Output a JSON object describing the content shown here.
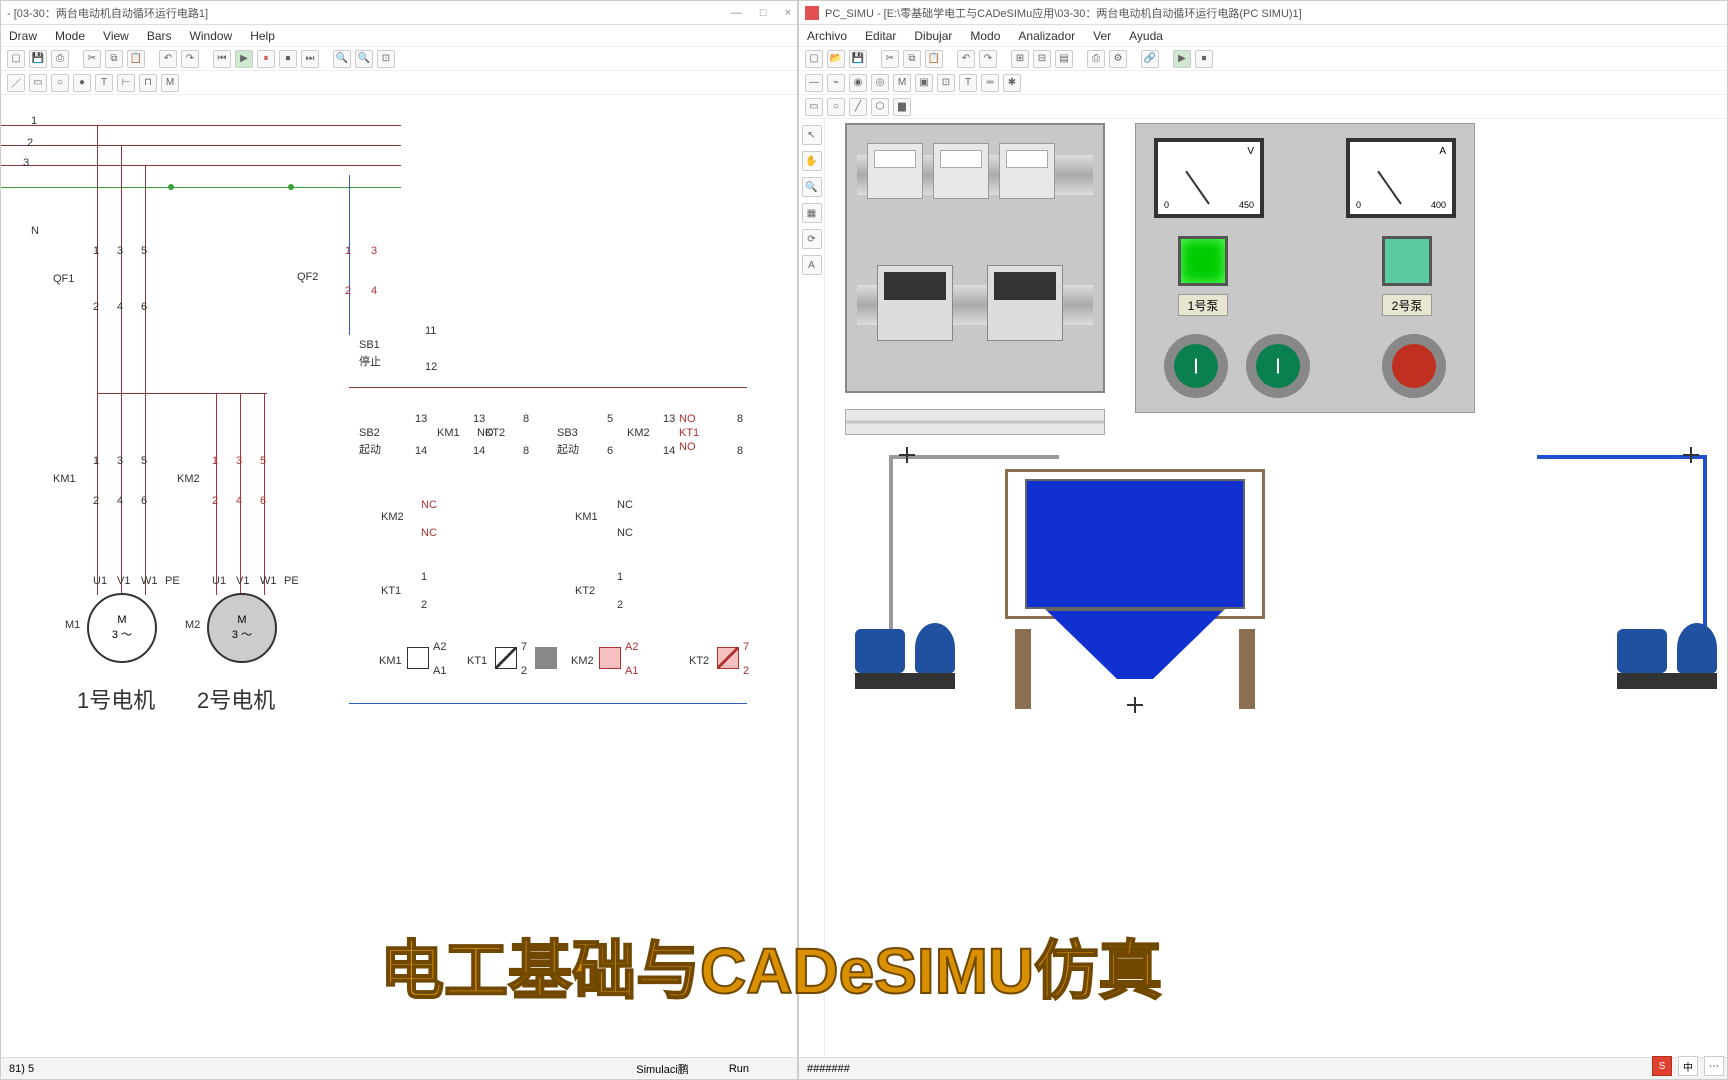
{
  "left_app": {
    "title": "- [03-30：两台电动机自动循环运行电路1]",
    "menus": [
      "Draw",
      "Mode",
      "View",
      "Bars",
      "Window",
      "Help"
    ],
    "status": {
      "left": "81) 5",
      "center": "Simulaci鹏",
      "right": "Run"
    }
  },
  "right_app": {
    "title": "PC_SIMU - [E:\\零基础学电工与CADeSIMu应用\\03-30：两台电动机自动循环运行电路(PC SIMU)1]",
    "menus": [
      "Archivo",
      "Editar",
      "Dibujar",
      "Modo",
      "Analizador",
      "Ver",
      "Ayuda"
    ],
    "status": "#######"
  },
  "schematic": {
    "phases": [
      "1",
      "2",
      "3",
      "N"
    ],
    "qf1": "QF1",
    "qf2": "QF2",
    "km1": "KM1",
    "km2": "KM2",
    "motor1": {
      "id": "M1",
      "label": "1号电机",
      "inside_top": "M",
      "inside_bot": "3 ～",
      "terms": [
        "U1",
        "V1",
        "W1",
        "PE"
      ]
    },
    "motor2": {
      "id": "M2",
      "label": "2号电机",
      "inside_top": "M",
      "inside_bot": "3 ～",
      "terms": [
        "U1",
        "V1",
        "W1",
        "PE"
      ]
    },
    "control": {
      "sb1": {
        "id": "SB1",
        "sub": "停止",
        "t": [
          "11",
          "12"
        ]
      },
      "sb2": {
        "id": "SB2",
        "sub": "起动",
        "t": [
          "13",
          "14"
        ]
      },
      "sb3": {
        "id": "SB3",
        "sub": "起动",
        "t": [
          "5",
          "6"
        ]
      },
      "km1b": {
        "id": "KM1",
        "t": [
          "13",
          "14"
        ],
        "c": "NO"
      },
      "km2b": {
        "id": "KM2",
        "t": [
          "13",
          "14"
        ],
        "c": "NO"
      },
      "kt1b": {
        "id": "KT1",
        "t": [
          "8",
          "8"
        ],
        "c": "NO"
      },
      "kt2b": {
        "id": "KT2",
        "t": [
          "8",
          "8"
        ],
        "c": "NO"
      },
      "km1nc": {
        "id": "KM1",
        "c": "NC"
      },
      "km2nc": {
        "id": "KM2",
        "c": "NC"
      },
      "kt1": {
        "id": "KT1",
        "t": [
          "1",
          "2"
        ]
      },
      "kt2": {
        "id": "KT2",
        "t": [
          "1",
          "2"
        ]
      },
      "coils": [
        {
          "id": "KM1",
          "t": [
            "A2",
            "A1"
          ]
        },
        {
          "id": "KT1",
          "t": [
            "7",
            "2"
          ]
        },
        {
          "id": "KM2",
          "t": [
            "A2",
            "A1"
          ]
        },
        {
          "id": "KT2",
          "t": [
            "7",
            "2"
          ]
        }
      ]
    },
    "contact_nums": {
      "top": [
        "1",
        "3",
        "5"
      ],
      "bot": [
        "2",
        "4",
        "6"
      ]
    }
  },
  "panel": {
    "meter1_unit": "V",
    "meter1_lo": "0",
    "meter1_hi": "450",
    "meter2_unit": "A",
    "meter2_lo": "0",
    "meter2_hi": "400",
    "lamp1": "1号泵",
    "lamp2": "2号泵",
    "btn_sym": "|"
  },
  "overlay": "电工基础与CADeSIMU仿真",
  "ime": {
    "s": "S",
    "lang": "中"
  }
}
